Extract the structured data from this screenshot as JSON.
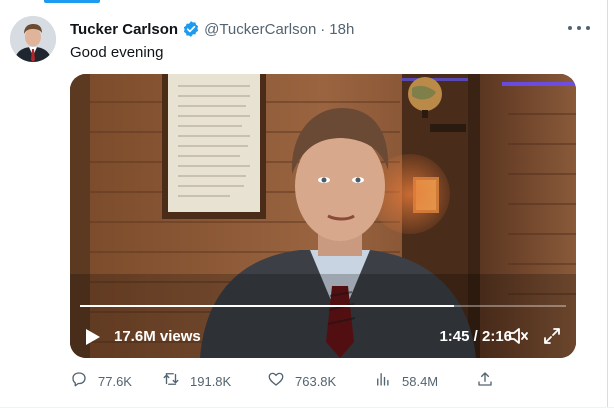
{
  "tweet": {
    "author_name": "Tucker Carlson",
    "handle": "@TuckerCarlson",
    "separator": "·",
    "time": "18h",
    "text": "Good evening"
  },
  "video": {
    "views": "17.6M views",
    "timecode": "1:45 / 2:16",
    "progress_fraction": 0.77
  },
  "actions": {
    "replies": "77.6K",
    "retweets": "191.8K",
    "likes": "763.8K",
    "views": "58.4M"
  },
  "icons": {
    "verified": "verified-badge-icon",
    "more": "more-dots-icon",
    "play": "play-icon",
    "volume": "volume-muted-icon",
    "fullscreen": "fullscreen-icon",
    "reply": "reply-icon",
    "retweet": "retweet-icon",
    "like": "heart-icon",
    "analytics": "analytics-icon",
    "share": "share-icon"
  },
  "colors": {
    "accent": "#1d9bf0",
    "secondary_text": "#536471",
    "primary_text": "#0f1419"
  }
}
